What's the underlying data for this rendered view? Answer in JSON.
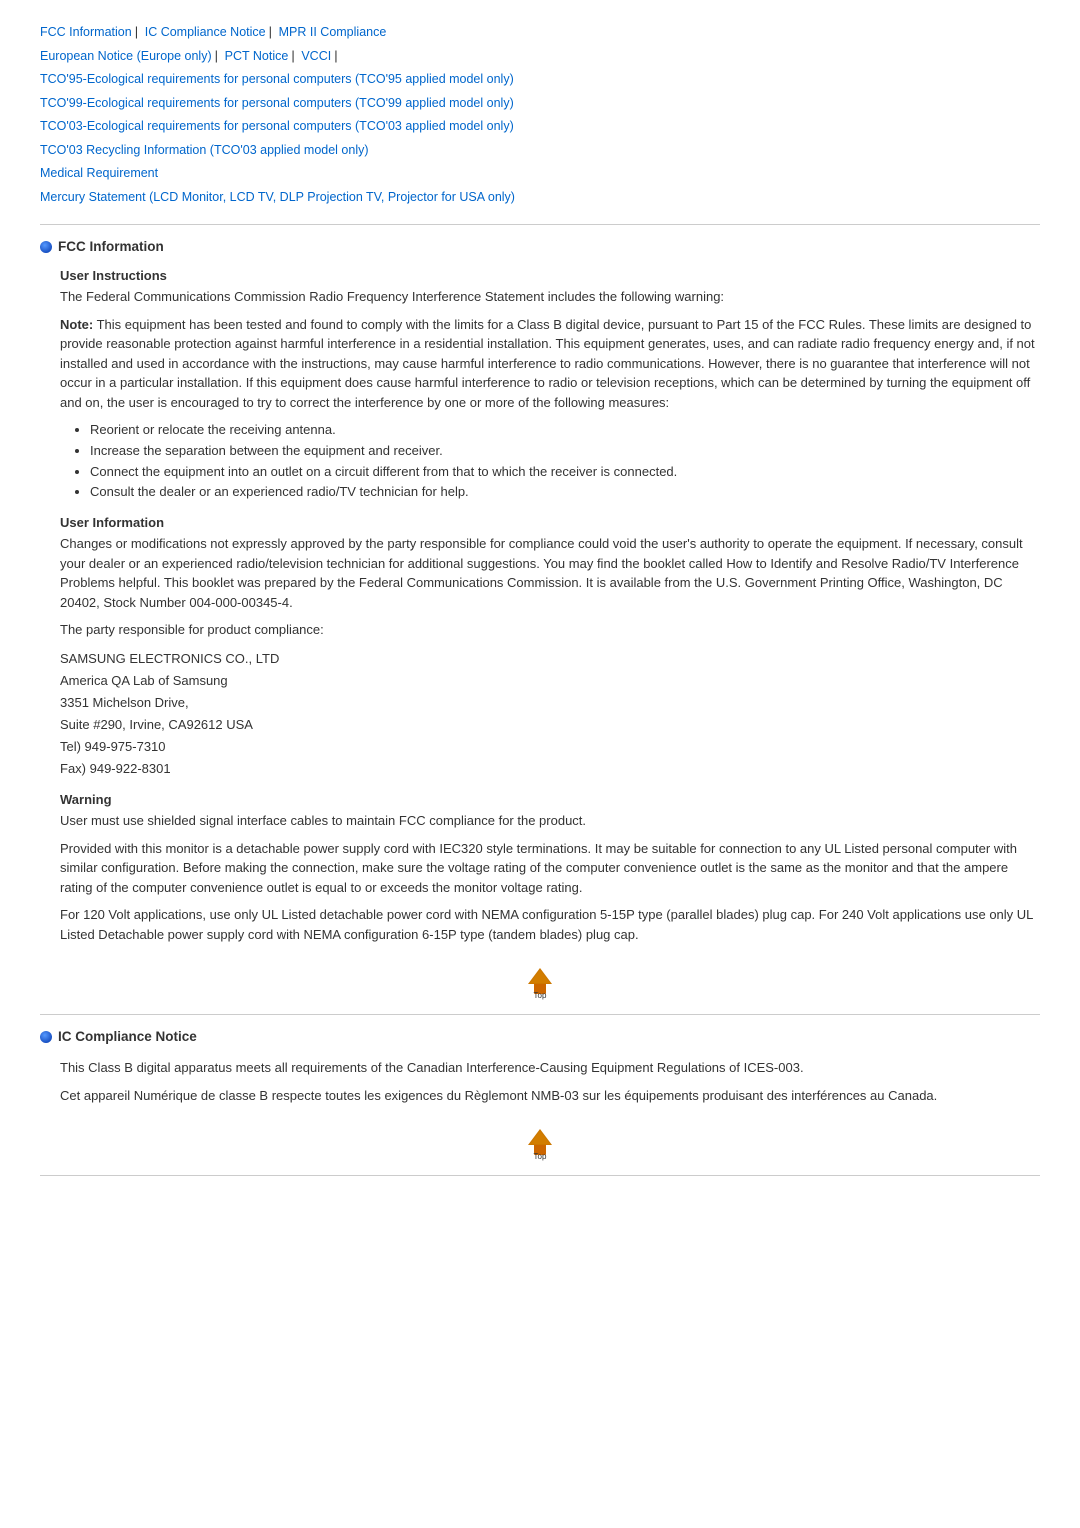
{
  "nav": {
    "links": [
      {
        "label": "FCC Information",
        "href": "#fcc"
      },
      {
        "label": "IC Compliance Notice",
        "href": "#ic"
      },
      {
        "label": "MPR II Compliance",
        "href": "#mpr"
      },
      {
        "label": "European Notice (Europe only)",
        "href": "#eu"
      },
      {
        "label": "PCT Notice",
        "href": "#pct"
      },
      {
        "label": "VCCI",
        "href": "#vcci"
      },
      {
        "label": "TCO'95-Ecological requirements for personal computers (TCO'95 applied model only)",
        "href": "#tco95"
      },
      {
        "label": "TCO'99-Ecological requirements for personal computers (TCO'99 applied model only)",
        "href": "#tco99"
      },
      {
        "label": "TCO'03-Ecological requirements for personal computers (TCO'03 applied model only)",
        "href": "#tco03"
      },
      {
        "label": "TCO'03 Recycling Information (TCO'03 applied model only)",
        "href": "#tco03r"
      },
      {
        "label": "Medical Requirement",
        "href": "#med"
      },
      {
        "label": "Mercury Statement (LCD Monitor, LCD TV, DLP Projection TV, Projector for USA only)",
        "href": "#mercury"
      }
    ]
  },
  "fcc": {
    "section_title": "FCC Information",
    "user_instructions": {
      "title": "User Instructions",
      "para1": "The Federal Communications Commission Radio Frequency Interference Statement includes the following warning:",
      "para2_strong": "Note:",
      "para2_rest": " This equipment has been tested and found to comply with the limits for a Class B digital device, pursuant to Part 15 of the FCC Rules. These limits are designed to provide reasonable protection against harmful interference in a residential installation. This equipment generates, uses, and can radiate radio frequency energy and, if not installed and used in accordance with the instructions, may cause harmful interference to radio communications. However, there is no guarantee that interference will not occur in a particular installation. If this equipment does cause harmful interference to radio or television receptions, which can be determined by turning the equipment off and on, the user is encouraged to try to correct the interference by one or more of the following measures:",
      "bullets": [
        "Reorient or relocate the receiving antenna.",
        "Increase the separation between the equipment and receiver.",
        "Connect the equipment into an outlet on a circuit different from that to which the receiver is connected.",
        "Consult the dealer or an experienced radio/TV technician for help."
      ]
    },
    "user_information": {
      "title": "User Information",
      "para1": "Changes or modifications not expressly approved by the party responsible for compliance could void the user's authority to operate the equipment. If necessary, consult your dealer or an experienced radio/television technician for additional suggestions. You may find the booklet called How to Identify and Resolve Radio/TV Interference Problems helpful. This booklet was prepared by the Federal Communications Commission. It is available from the U.S. Government Printing Office, Washington, DC 20402, Stock Number 004-000-00345-4.",
      "para2": "The party responsible for product compliance:",
      "address": "SAMSUNG ELECTRONICS CO., LTD\nAmerica QA Lab of Samsung\n3351 Michelson Drive,\nSuite #290, Irvine, CA92612 USA\nTel) 949-975-7310\nFax) 949-922-8301"
    },
    "warning": {
      "title": "Warning",
      "para1": "User must use shielded signal interface cables to maintain FCC compliance for the product.",
      "para2": "Provided with this monitor is a detachable power supply cord with IEC320 style terminations. It may be suitable for connection to any UL Listed personal computer with similar configuration. Before making the connection, make sure the voltage rating of the computer convenience outlet is the same as the monitor and that the ampere rating of the computer convenience outlet is equal to or exceeds the monitor voltage rating.",
      "para3": "For 120 Volt applications, use only UL Listed detachable power cord with NEMA configuration 5-15P type (parallel blades) plug cap. For 240 Volt applications use only UL Listed Detachable power supply cord with NEMA configuration 6-15P type (tandem blades) plug cap."
    }
  },
  "ic": {
    "section_title": "IC Compliance Notice",
    "para1": "This Class B digital apparatus meets all requirements of the Canadian Interference-Causing Equipment Regulations of ICES-003.",
    "para2": "Cet appareil Numérique de classe B respecte toutes les exigences du Règlemont NMB-03 sur les équipements produisant des interférences au Canada."
  },
  "top_button_label": "Top"
}
